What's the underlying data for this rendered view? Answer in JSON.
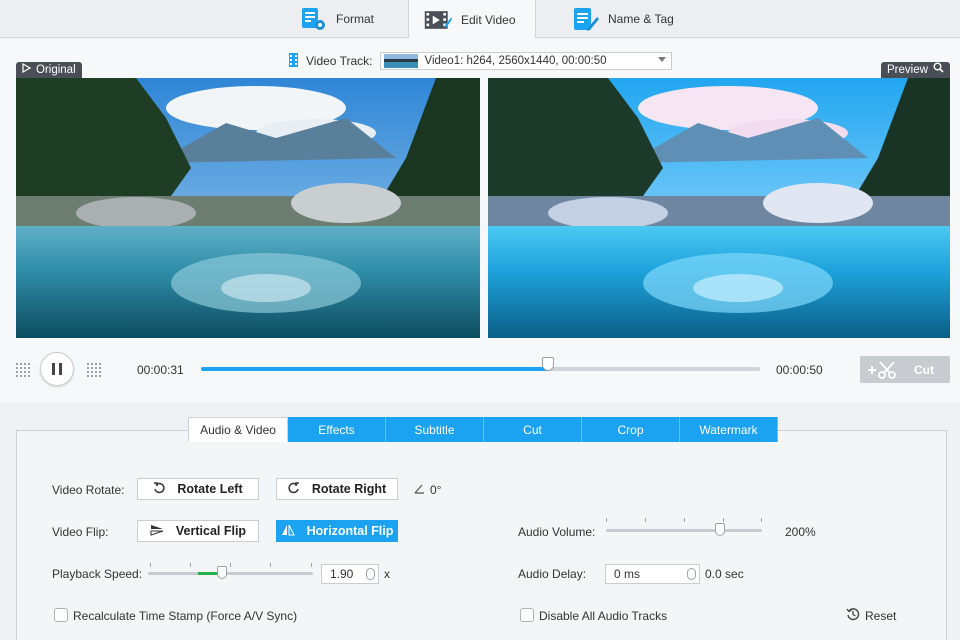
{
  "top_tabs": [
    {
      "label": "Format",
      "icon": "format-settings-icon"
    },
    {
      "label": "Edit Video",
      "icon": "edit-video-icon",
      "active": true
    },
    {
      "label": "Name & Tag",
      "icon": "name-tag-icon"
    }
  ],
  "preview": {
    "original_label": "Original",
    "preview_label": "Preview",
    "video_track_label": "Video Track:",
    "video_track_value": "Video1: h264, 2560x1440, 00:00:50"
  },
  "playback": {
    "current_time": "00:00:31",
    "total_time": "00:00:50",
    "progress": 0.62,
    "cut_label": "Cut"
  },
  "sub_tabs": [
    {
      "label": "Audio & Video",
      "active": true
    },
    {
      "label": "Effects"
    },
    {
      "label": "Subtitle"
    },
    {
      "label": "Cut"
    },
    {
      "label": "Crop"
    },
    {
      "label": "Watermark"
    }
  ],
  "controls": {
    "video_rotate_label": "Video Rotate:",
    "rotate_left": "Rotate Left",
    "rotate_right": "Rotate Right",
    "rotate_value": "0°",
    "video_flip_label": "Video Flip:",
    "vertical_flip": "Vertical Flip",
    "horizontal_flip": "Horizontal Flip",
    "playback_speed_label": "Playback Speed:",
    "playback_speed_value": "1.90",
    "playback_speed_unit": "x",
    "playback_speed_level": 0.45,
    "recalc_label": "Recalculate Time Stamp (Force A/V Sync)",
    "audio_volume_label": "Audio Volume:",
    "audio_volume_value": "200%",
    "audio_volume_level": 0.73,
    "audio_delay_label": "Audio Delay:",
    "audio_delay_value": "0 ms",
    "audio_delay_display": "0.0 sec",
    "disable_audio_label": "Disable All Audio Tracks",
    "reset_label": "Reset"
  },
  "colors": {
    "accent": "#1ba3f2",
    "speed_fill": "#27b34b"
  }
}
